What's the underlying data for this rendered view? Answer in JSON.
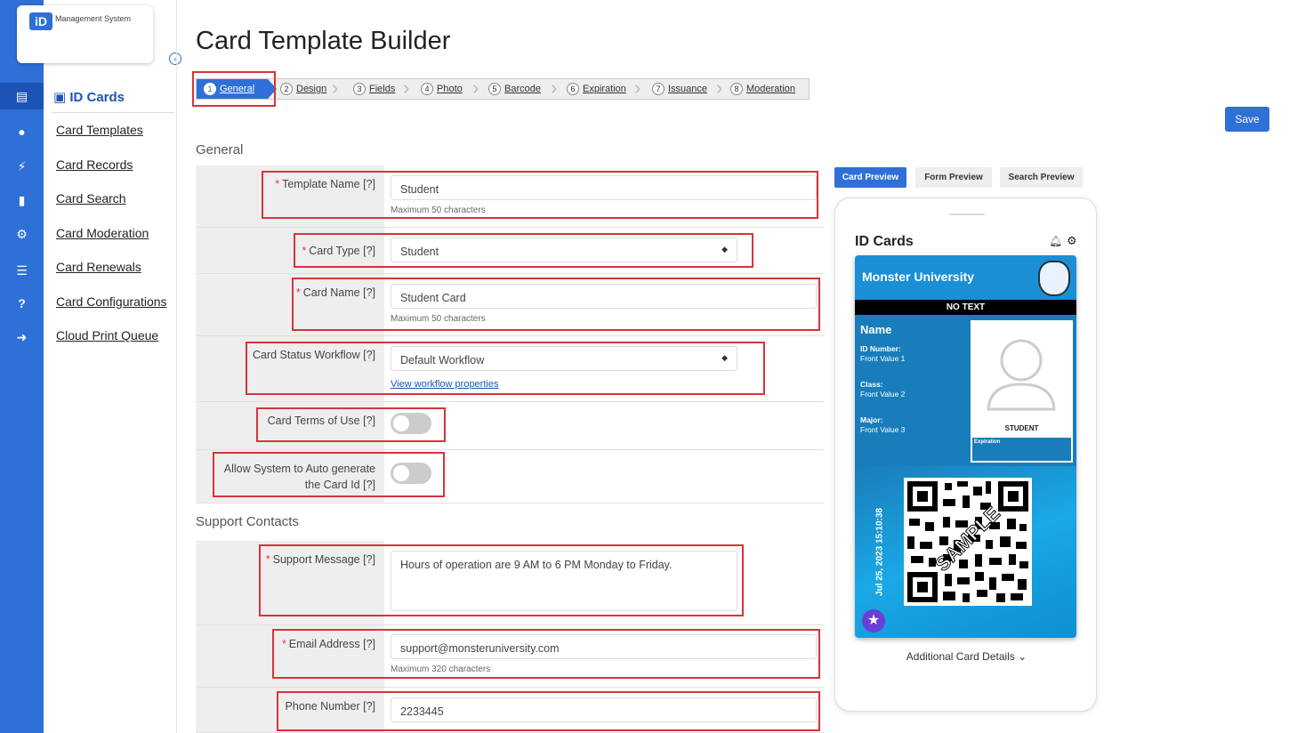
{
  "app": {
    "logo_mark": "iD",
    "logo_text": "Management System"
  },
  "rail_icons": [
    "id-card-icon",
    "chat-icon",
    "plug-icon",
    "document-icon",
    "gear-icon",
    "list-icon",
    "help-icon",
    "logout-icon"
  ],
  "sidebar": {
    "title": "ID Cards",
    "items": [
      "Card Templates",
      "Card Records",
      "Card Search",
      "Card Moderation",
      "Card Renewals",
      "Card Configurations",
      "Cloud Print Queue"
    ]
  },
  "page_title": "Card Template Builder",
  "steps": [
    {
      "num": "1",
      "label": "General"
    },
    {
      "num": "2",
      "label": "Design"
    },
    {
      "num": "3",
      "label": "Fields"
    },
    {
      "num": "4",
      "label": "Photo"
    },
    {
      "num": "5",
      "label": "Barcode"
    },
    {
      "num": "6",
      "label": "Expiration"
    },
    {
      "num": "7",
      "label": "Issuance"
    },
    {
      "num": "8",
      "label": "Moderation"
    }
  ],
  "save_label": "Save",
  "general": {
    "section": "General",
    "template_name": {
      "label": "Template Name [?]",
      "value": "Student",
      "hint": "Maximum 50 characters"
    },
    "card_type": {
      "label": "Card Type [?]",
      "value": "Student"
    },
    "card_name": {
      "label": "Card Name [?]",
      "value": "Student Card",
      "hint": "Maximum 50 characters"
    },
    "workflow": {
      "label": "Card Status Workflow [?]",
      "value": "Default Workflow",
      "link": "View workflow properties"
    },
    "terms": {
      "label": "Card Terms of Use [?]",
      "on": false
    },
    "auto_id": {
      "label": "Allow System to Auto generate the Card Id [?]",
      "on": false
    }
  },
  "support": {
    "section": "Support Contacts",
    "message": {
      "label": "Support Message [?]",
      "value": "Hours of operation are 9 AM to 6 PM Monday to Friday."
    },
    "email": {
      "label": "Email Address [?]",
      "value": "support@monsteruniversity.com",
      "hint": "Maximum 320 characters"
    },
    "phone": {
      "label": "Phone Number [?]",
      "value": "2233445"
    }
  },
  "preview_tabs": [
    "Card Preview",
    "Form Preview",
    "Search Preview"
  ],
  "preview": {
    "header": "ID Cards",
    "university": "Monster University",
    "banner": "NO TEXT",
    "name_label": "Name",
    "fields": [
      {
        "label": "ID Number:",
        "value": "Front Value 1"
      },
      {
        "label": "Class:",
        "value": "Front Value 2"
      },
      {
        "label": "Major:",
        "value": "Front Value 3"
      }
    ],
    "photo_caption": "STUDENT",
    "expiration_label": "Expiration",
    "timestamp": "Jul 25, 2023 15:10:38",
    "qr_watermark": "SAMPLE",
    "details_link": "Additional Card Details"
  },
  "colors": {
    "primary": "#2f6fd8",
    "highlight": "#d9333a",
    "card_blue": "#1a8fd6"
  }
}
